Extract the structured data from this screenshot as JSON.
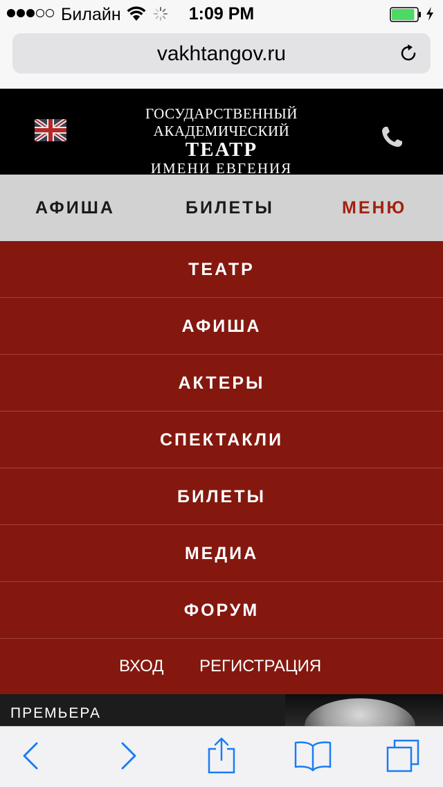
{
  "status_bar": {
    "carrier": "Билайн",
    "time": "1:09 PM",
    "signal_bars_filled": 3,
    "signal_bars_total": 5,
    "battery_level": 0.9,
    "battery_color": "#4cd964"
  },
  "browser": {
    "url": "vakhtangov.ru"
  },
  "header": {
    "logo_line1": "ГОСУДАРСТВЕННЫЙ АКАДЕМИЧЕСКИЙ",
    "logo_line2": "ТЕАТР",
    "logo_line3": "ИМЕНИ ЕВГЕНИЯ ВАХТАНГОВА",
    "language_icon": "uk-flag-icon",
    "call_icon": "phone-icon"
  },
  "top_nav": {
    "items": [
      {
        "label": "АФИША"
      },
      {
        "label": "БИЛЕТЫ"
      },
      {
        "label": "МЕНЮ"
      }
    ],
    "active_color": "#a3200f"
  },
  "menu": {
    "background": "#84180f",
    "items": [
      {
        "label": "ТЕАТР"
      },
      {
        "label": "АФИША"
      },
      {
        "label": "АКТЕРЫ"
      },
      {
        "label": "СПЕКТАКЛИ"
      },
      {
        "label": "БИЛЕТЫ"
      },
      {
        "label": "МЕДИА"
      },
      {
        "label": "ФОРУМ"
      }
    ],
    "login": "ВХОД",
    "register": "РЕГИСТРАЦИЯ"
  },
  "banner": {
    "label": "ПРЕМЬЕРА"
  },
  "toolbar": {
    "icons": [
      "back-icon",
      "forward-icon",
      "share-icon",
      "bookmarks-icon",
      "tabs-icon"
    ],
    "accent": "#1a7cf5"
  }
}
